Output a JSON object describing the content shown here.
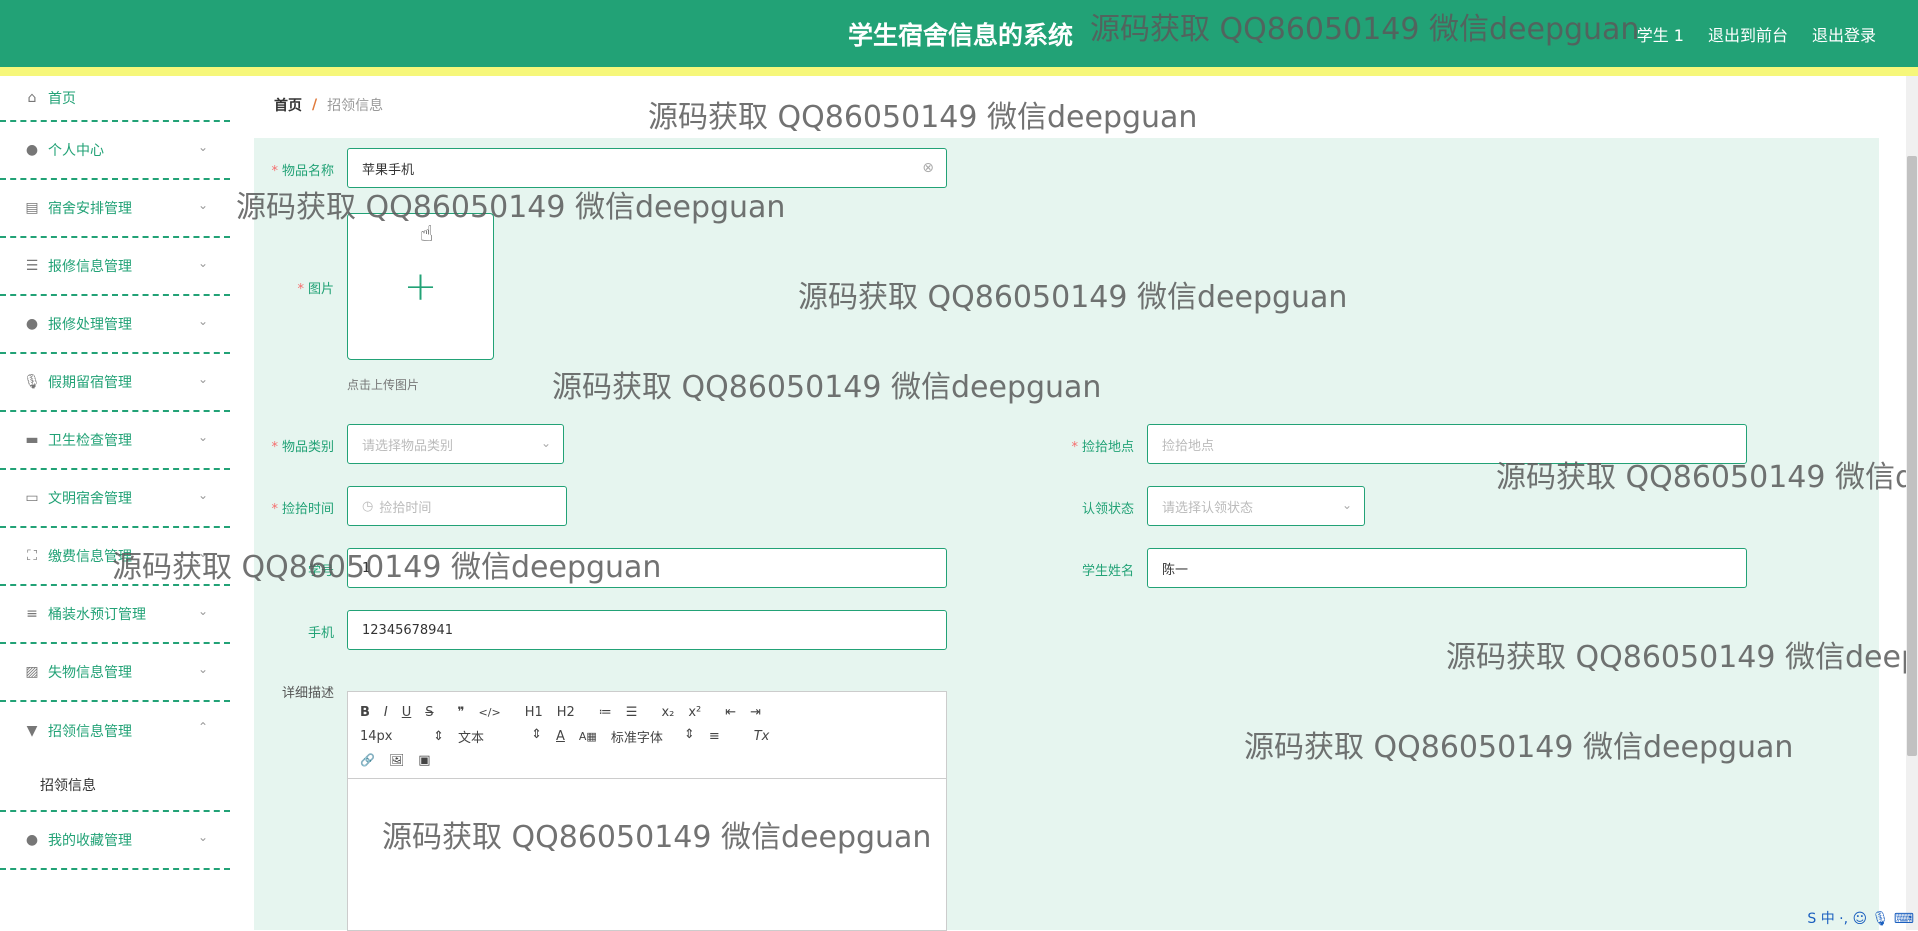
{
  "header": {
    "title": "学生宿舍信息的系统",
    "links": [
      "学生 1",
      "退出到前台",
      "退出登录"
    ]
  },
  "sidebar": {
    "items": [
      {
        "label": "首页",
        "icon": "home-icon",
        "glyph": "⌂"
      },
      {
        "label": "个人中心",
        "icon": "user-icon",
        "glyph": "●"
      },
      {
        "label": "宿舍安排管理",
        "icon": "clipboard-icon",
        "glyph": "▤"
      },
      {
        "label": "报修信息管理",
        "icon": "sliders-icon",
        "glyph": "☰"
      },
      {
        "label": "报修处理管理",
        "icon": "person-icon",
        "glyph": "●"
      },
      {
        "label": "假期留宿管理",
        "icon": "microphone-icon",
        "glyph": "🎙"
      },
      {
        "label": "卫生检查管理",
        "icon": "briefcase-icon",
        "glyph": "▬"
      },
      {
        "label": "文明宿舍管理",
        "icon": "monitor-icon",
        "glyph": "▭"
      },
      {
        "label": "缴费信息管理",
        "icon": "fullscreen-icon",
        "glyph": "⛶"
      },
      {
        "label": "桶装水预订管理",
        "icon": "list-icon",
        "glyph": "≡"
      },
      {
        "label": "失物信息管理",
        "icon": "chart-icon",
        "glyph": "▨"
      },
      {
        "label": "招领信息管理",
        "icon": "stamp-icon",
        "glyph": "▼"
      },
      {
        "label": "我的收藏管理",
        "icon": "user-star-icon",
        "glyph": "●"
      }
    ],
    "active_sub": "招领信息"
  },
  "breadcrumb": {
    "home": "首页",
    "sep": "/",
    "current": "招领信息"
  },
  "form": {
    "item_name": {
      "label": "物品名称",
      "value": "苹果手机"
    },
    "image": {
      "label": "图片",
      "tip": "点击上传图片"
    },
    "category": {
      "label": "物品类别",
      "placeholder": "请选择物品类别"
    },
    "pick_place": {
      "label": "捡拾地点",
      "placeholder": "捡拾地点"
    },
    "pick_time": {
      "label": "捡拾时间",
      "placeholder": "捡拾时间"
    },
    "claim_status": {
      "label": "认领状态",
      "placeholder": "请选择认领状态"
    },
    "student_id": {
      "label": "学号",
      "value": "1"
    },
    "student_name": {
      "label": "学生姓名",
      "value": "陈一"
    },
    "phone": {
      "label": "手机",
      "value": "12345678941"
    },
    "description": {
      "label": "详细描述"
    }
  },
  "editor": {
    "row1": [
      "B",
      "I",
      "U",
      "S",
      "❞",
      "</>",
      "H1",
      "H2",
      "≔",
      "☰",
      "x₂",
      "x²",
      "⇤",
      "⇥"
    ],
    "font_size": "14px",
    "text_type": "文本",
    "font_family": "标准字体",
    "row2_icons": [
      "A",
      "A▦",
      "≡",
      "Tx"
    ],
    "row3": [
      "🔗",
      "🖼",
      "▣"
    ]
  },
  "watermark": "源码获取 QQ86050149 微信deepguan",
  "ime": "S 中 ·, ☺ 🎙 ⌨"
}
